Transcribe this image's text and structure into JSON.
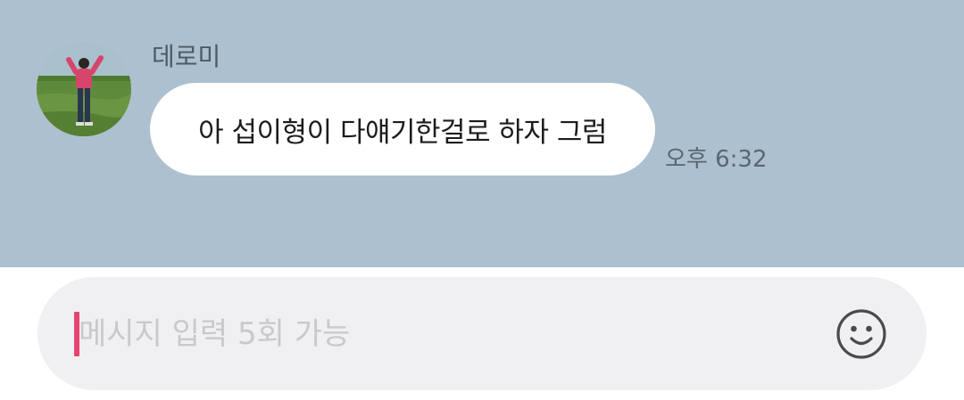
{
  "chat": {
    "sender_name": "데로미",
    "avatar_icon": "profile-photo",
    "message_text": "아 섭이형이 다얘기한걸로 하자 그럼",
    "timestamp": "오후 6:32"
  },
  "input": {
    "placeholder": "메시지 입력 5회 가능",
    "value": "",
    "emoji_icon": "smiley-icon"
  },
  "colors": {
    "chat_background": "#adc0cf",
    "bubble": "#ffffff",
    "input_background": "#f0f0f3",
    "caret": "#e5456d"
  }
}
